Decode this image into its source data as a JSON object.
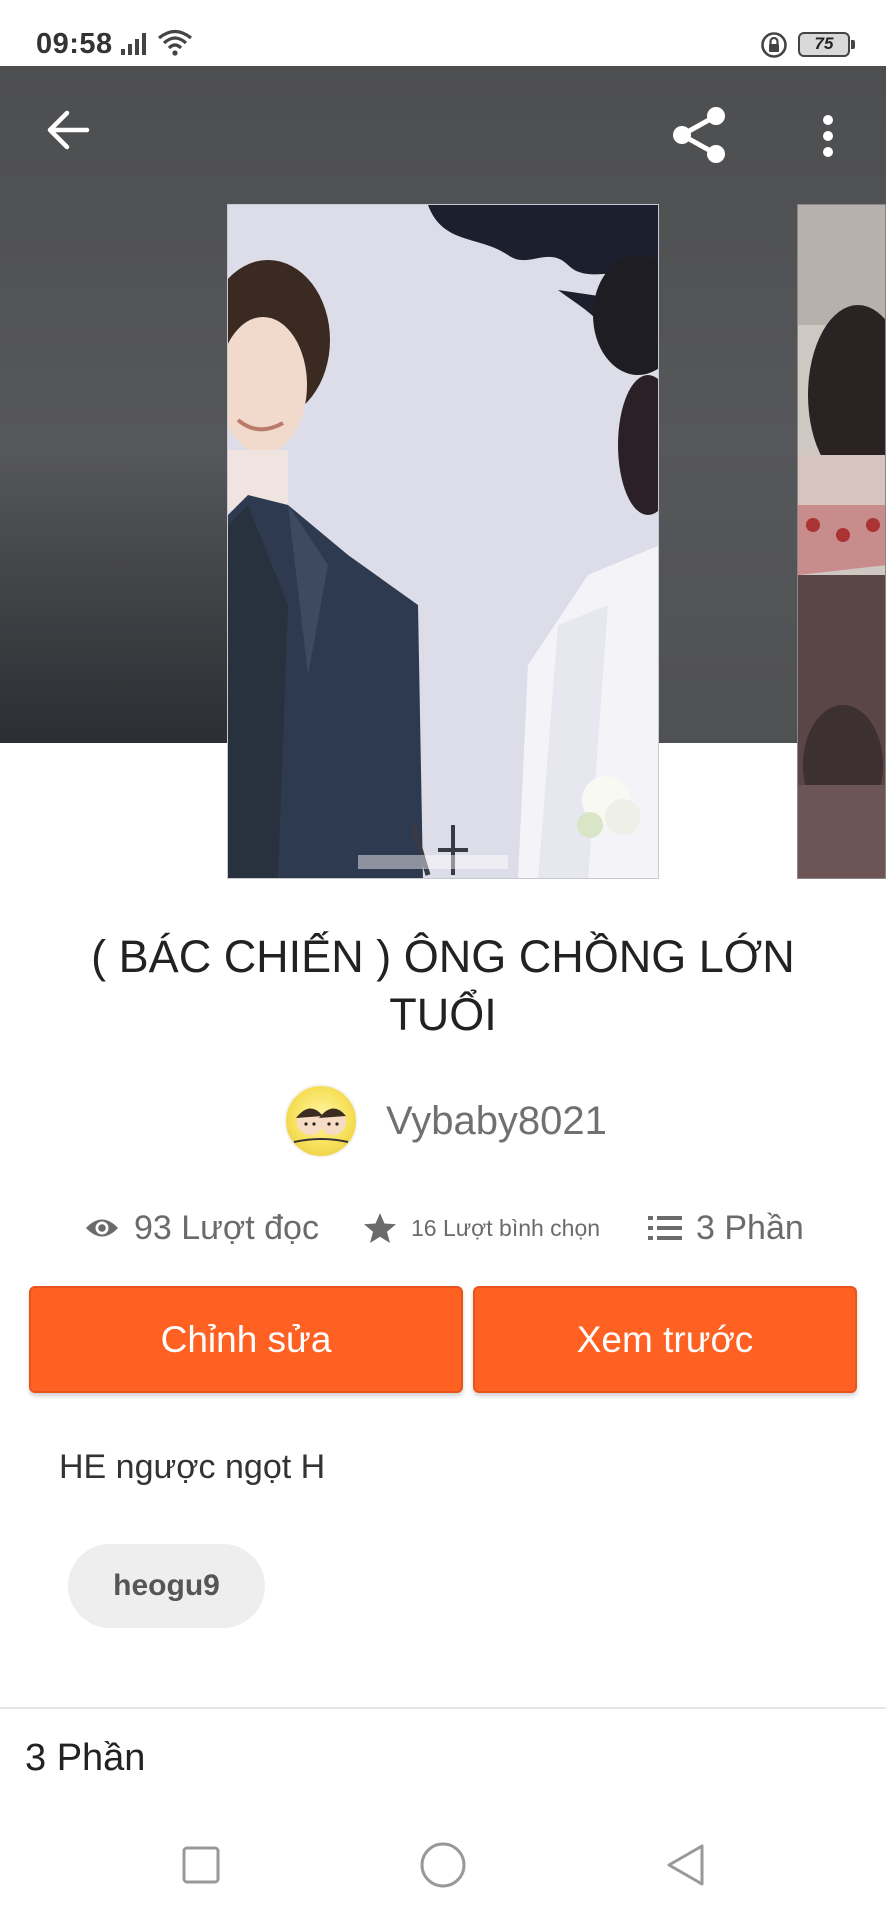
{
  "status_bar": {
    "time": "09:58",
    "battery": "75",
    "icons": [
      "signal-icon",
      "wifi-icon",
      "rotation-lock-icon",
      "battery-icon"
    ]
  },
  "header": {
    "icons": [
      "back-arrow-icon",
      "share-icon",
      "more-vertical-icon"
    ]
  },
  "story": {
    "title": "( BÁC CHIẾN ) ÔNG CHỒNG LỚN TUỔI",
    "author": "Vybaby8021",
    "stats": {
      "reads": "93 Lượt đọc",
      "votes": "16 Lượt bình chọn",
      "parts": "3 Phần"
    },
    "description": "HE ngược ngọt H",
    "tags": [
      "heogu9"
    ]
  },
  "actions": {
    "edit_label": "Chỉnh sửa",
    "preview_label": "Xem trước"
  },
  "parts_section": {
    "heading": "3 Phần"
  },
  "colors": {
    "accent": "#ff6122",
    "header_bg": "#505153",
    "text_muted": "#6b6b6b"
  }
}
